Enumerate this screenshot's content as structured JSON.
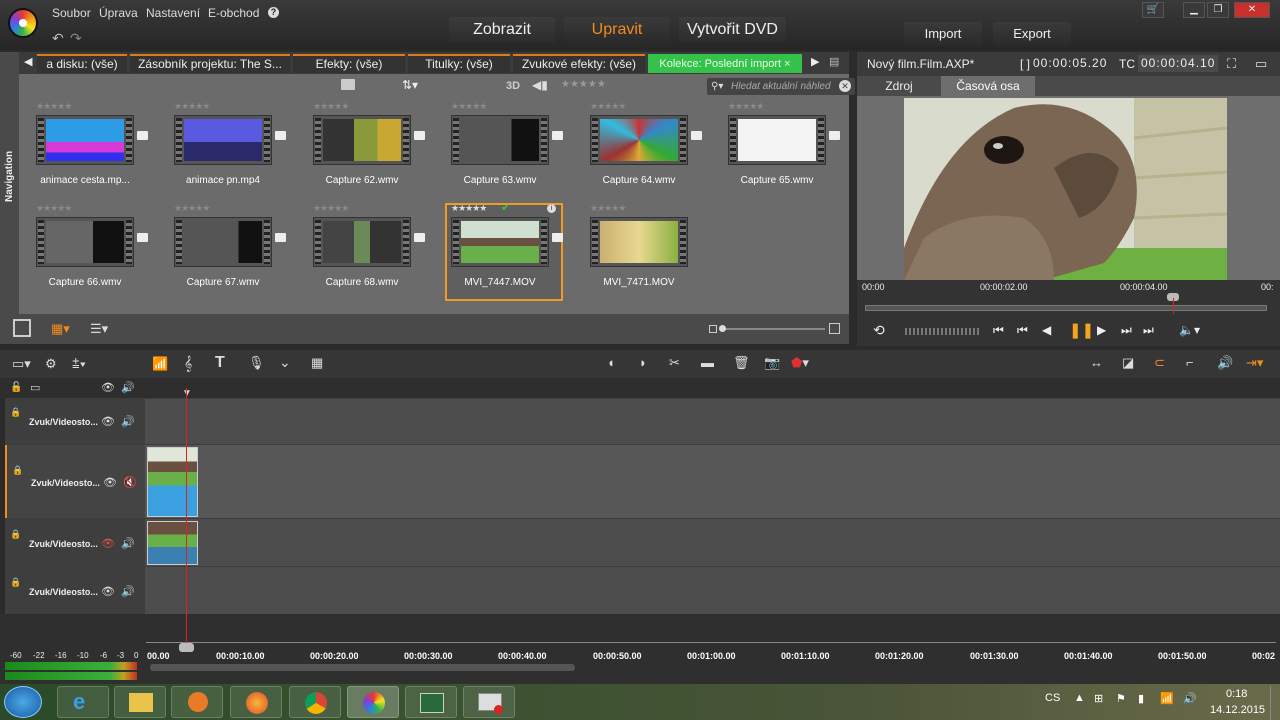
{
  "menu": {
    "file": "Soubor",
    "edit": "Úprava",
    "settings": "Nastavení",
    "eshop": "E-obchod",
    "help": "?"
  },
  "modes": {
    "view": "Zobrazit",
    "edit": "Upravit",
    "dvd": "Vytvořit DVD"
  },
  "io": {
    "import": "Import",
    "export": "Export"
  },
  "library": {
    "nav_label": "Navigation",
    "tabs": [
      "a disku: (vše)",
      "Zásobník projektu: The S...",
      "Efekty: (vše)",
      "Titulky: (vše)",
      "Zvukové efekty: (vše)",
      "Kolekce: Poslední import"
    ],
    "filter_3d": "3D",
    "search_placeholder": "Hledat aktuální náhled",
    "items": [
      {
        "name": "animace cesta.mp..."
      },
      {
        "name": "animace pn.mp4"
      },
      {
        "name": "Capture 62.wmv"
      },
      {
        "name": "Capture 63.wmv"
      },
      {
        "name": "Capture 64.wmv"
      },
      {
        "name": "Capture 65.wmv"
      },
      {
        "name": "Capture 66.wmv"
      },
      {
        "name": "Capture 67.wmv"
      },
      {
        "name": "Capture 68.wmv"
      },
      {
        "name": "MVI_7447.MOV",
        "selected": true
      },
      {
        "name": "MVI_7471.MOV"
      }
    ]
  },
  "preview": {
    "title": "Nový film.Film.AXP*",
    "duration_label": "[ ]",
    "duration": "00:00:05.20",
    "tc_label": "TC",
    "tc": "00:00:04.10",
    "tab_source": "Zdroj",
    "tab_timeline": "Časová osa",
    "ruler": [
      "00:00",
      "00:00:02.00",
      "00:00:04.00",
      "00:"
    ]
  },
  "timeline": {
    "tracks": [
      "Zvuk/Videosto...",
      "Zvuk/Videosto...",
      "Zvuk/Videosto...",
      "Zvuk/Videosto..."
    ],
    "meter_labels": [
      "-60",
      "-22",
      "-16",
      "-10",
      "-6",
      "-3",
      "0"
    ],
    "ticks": [
      "00.00",
      "00:00:10.00",
      "00:00:20.00",
      "00:00:30.00",
      "00:00:40.00",
      "00:00:50.00",
      "00:01:00.00",
      "00:01:10.00",
      "00:01:20.00",
      "00:01:30.00",
      "00:01:40.00",
      "00:01:50.00",
      "00:02"
    ]
  },
  "taskbar": {
    "lang": "CS",
    "time": "0:18",
    "date": "14.12.2015"
  },
  "colors": {
    "accent": "#f28c1d",
    "green_tab": "#34c24a",
    "playhead": "#dd2222"
  }
}
